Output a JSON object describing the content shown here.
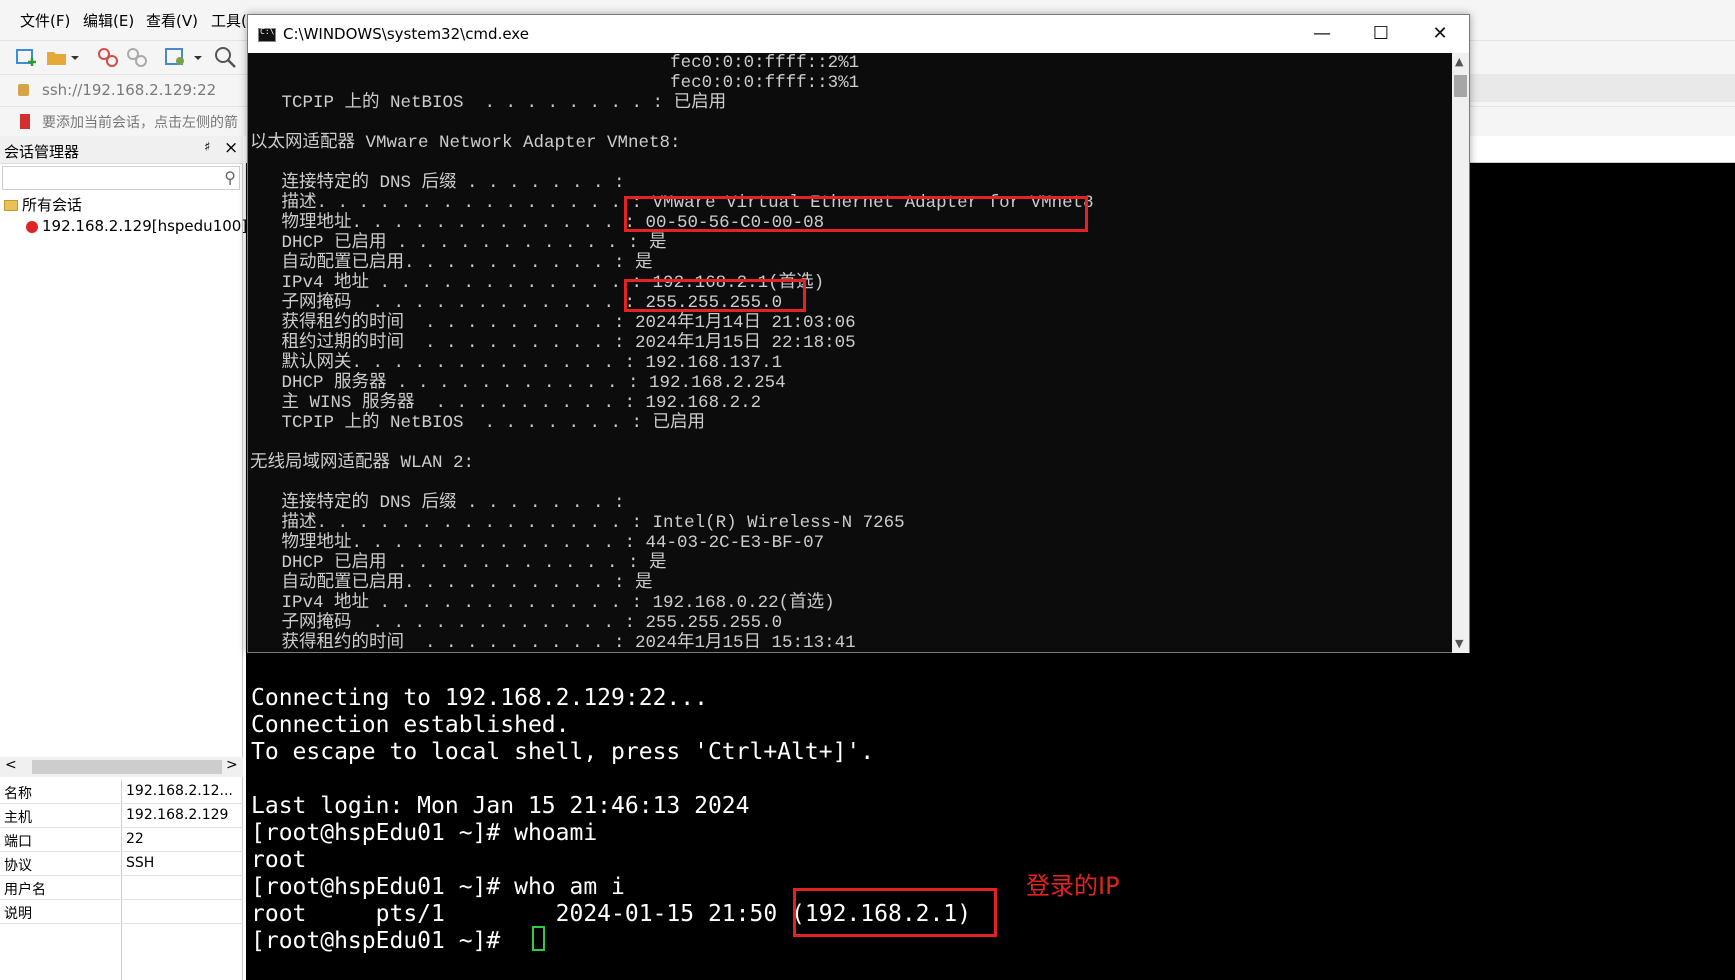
{
  "xshell": {
    "menu": [
      "文件(F)",
      "编辑(E)",
      "查看(V)",
      "工具("
    ],
    "address": "ssh://192.168.2.129:22",
    "tip": "要添加当前会话，点击左侧的箭",
    "session_manager": {
      "title": "会话管理器",
      "pin": "♯",
      "close": "×",
      "tree_root": "所有会话",
      "tree_session": "192.168.2.129[hspedu100]",
      "properties": [
        {
          "key": "名称",
          "value": "192.168.2.12..."
        },
        {
          "key": "主机",
          "value": "192.168.2.129"
        },
        {
          "key": "端口",
          "value": "22"
        },
        {
          "key": "协议",
          "value": "SSH"
        },
        {
          "key": "用户名",
          "value": ""
        },
        {
          "key": "说明",
          "value": ""
        }
      ]
    },
    "terminal_lines": [
      "Connecting to 192.168.2.129:22...",
      "Connection established.",
      "To escape to local shell, press 'Ctrl+Alt+]'.",
      "",
      "Last login: Mon Jan 15 21:46:13 2024",
      "[root@hspEdu01 ~]# whoami",
      "root",
      "[root@hspEdu01 ~]# who am i",
      "root     pts/1        2024-01-15 21:50 (192.168.2.1)",
      "[root@hspEdu01 ~]# "
    ],
    "annotation": "登录的IP"
  },
  "cmd": {
    "title": "C:\\WINDOWS\\system32\\cmd.exe",
    "min": "—",
    "max": "☐",
    "close": "✕",
    "lines": [
      "                                        fec0:0:0:ffff::2%1",
      "                                        fec0:0:0:ffff::3%1",
      "   TCPIP 上的 NetBIOS  . . . . . . . . : 已启用",
      "",
      "以太网适配器 VMware Network Adapter VMnet8:",
      "",
      "   连接特定的 DNS 后缀 . . . . . . . :",
      "   描述. . . . . . . . . . . . . . . : VMware Virtual Ethernet Adapter for VMnet8",
      "   物理地址. . . . . . . . . . . . . : 00-50-56-C0-00-08",
      "   DHCP 已启用 . . . . . . . . . . . : 是",
      "   自动配置已启用. . . . . . . . . . : 是",
      "   IPv4 地址 . . . . . . . . . . . . : 192.168.2.1(首选)",
      "   子网掩码  . . . . . . . . . . . . : 255.255.255.0",
      "   获得租约的时间  . . . . . . . . . : 2024年1月14日 21:03:06",
      "   租约过期的时间  . . . . . . . . . : 2024年1月15日 22:18:05",
      "   默认网关. . . . . . . . . . . . . : 192.168.137.1",
      "   DHCP 服务器 . . . . . . . . . . . : 192.168.2.254",
      "   主 WINS 服务器  . . . . . . . . . : 192.168.2.2",
      "   TCPIP 上的 NetBIOS  . . . . . . . : 已启用",
      "",
      "无线局域网适配器 WLAN 2:",
      "",
      "   连接特定的 DNS 后缀 . . . . . . . :",
      "   描述. . . . . . . . . . . . . . . : Intel(R) Wireless-N 7265",
      "   物理地址. . . . . . . . . . . . . : 44-03-2C-E3-BF-07",
      "   DHCP 已启用 . . . . . . . . . . . : 是",
      "   自动配置已启用. . . . . . . . . . : 是",
      "   IPv4 地址 . . . . . . . . . . . . : 192.168.0.22(首选)",
      "   子网掩码  . . . . . . . . . . . . : 255.255.255.0",
      "   获得租约的时间  . . . . . . . . . : 2024年1月15日 15:13:41"
    ]
  },
  "colors": {
    "highlight": "#e32222",
    "cursor": "#2ecc40",
    "terminal_bg": "#000000",
    "cmd_text": "#cccccc"
  }
}
